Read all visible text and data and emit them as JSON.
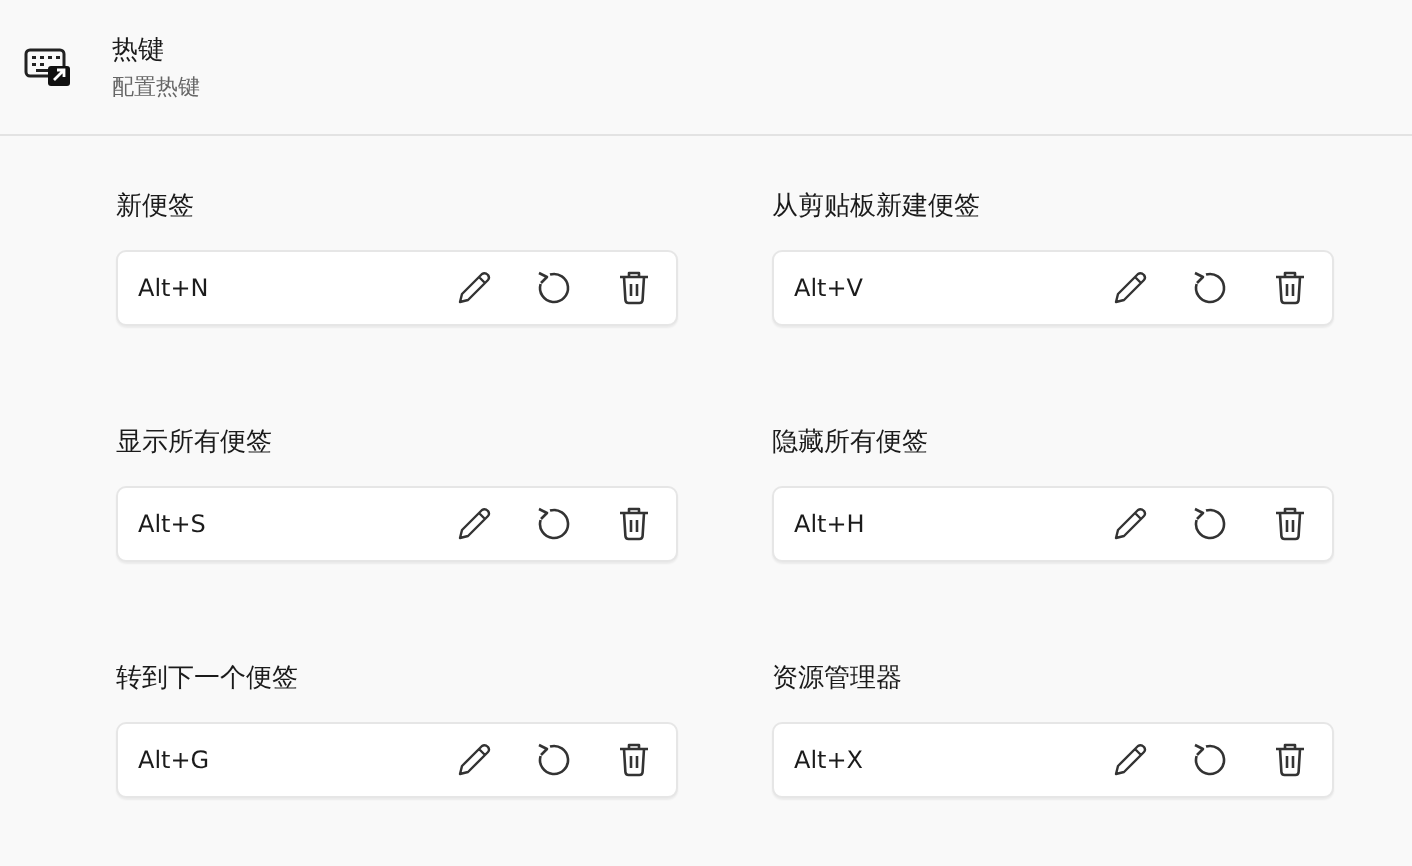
{
  "header": {
    "title": "热键",
    "subtitle": "配置热键"
  },
  "hotkeys": [
    {
      "label": "新便签",
      "value": "Alt+N"
    },
    {
      "label": "从剪贴板新建便签",
      "value": "Alt+V"
    },
    {
      "label": "显示所有便签",
      "value": "Alt+S"
    },
    {
      "label": "隐藏所有便签",
      "value": "Alt+H"
    },
    {
      "label": "转到下一个便签",
      "value": "Alt+G"
    },
    {
      "label": "资源管理器",
      "value": "Alt+X"
    }
  ]
}
